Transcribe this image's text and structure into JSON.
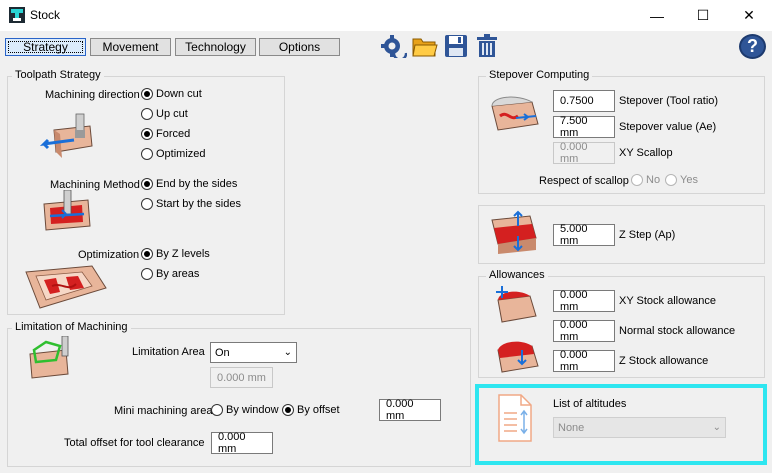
{
  "window": {
    "title": "Stock",
    "minimize_glyph": "—",
    "maximize_glyph": "☐",
    "close_glyph": "✕"
  },
  "tabs": [
    {
      "label": "Strategy",
      "active": true
    },
    {
      "label": "Movement"
    },
    {
      "label": "Technology"
    },
    {
      "label": "Options"
    }
  ],
  "toolbar": {
    "icons": [
      "settings-refresh-icon",
      "open-folder-icon",
      "save-icon",
      "trash-icon",
      "help-icon"
    ],
    "help_glyph": "?"
  },
  "toolpath_strategy": {
    "title": "Toolpath Strategy",
    "machining_direction": {
      "label": "Machining direction",
      "options": [
        "Down cut",
        "Up cut",
        "Forced",
        "Optimized"
      ],
      "selected": [
        "Down cut",
        "Forced"
      ]
    },
    "machining_method": {
      "label": "Machining Method",
      "options": [
        "End by the sides",
        "Start by the sides"
      ],
      "selected": "End by the sides"
    },
    "optimization": {
      "label": "Optimization",
      "options": [
        "By Z levels",
        "By areas"
      ],
      "selected": "By Z levels"
    }
  },
  "limitation": {
    "title": "Limitation of Machining",
    "area_label": "Limitation Area",
    "area_value": "On",
    "area_offset": "0.000 mm",
    "mini_label": "Mini machining area",
    "mini_options": [
      "By window",
      "By offset"
    ],
    "mini_selected": "By offset",
    "mini_value": "0.000 mm",
    "clearance_label": "Total offset for tool clearance",
    "clearance_value": "0.000 mm"
  },
  "stepover": {
    "title": "Stepover Computing",
    "tool_ratio_value": "0.7500",
    "tool_ratio_label": "Stepover (Tool ratio)",
    "ae_value": "7.500 mm",
    "ae_label": "Stepover value (Ae)",
    "scallop_value": "0.000 mm",
    "scallop_label": "XY Scallop",
    "respect_label": "Respect of scallop",
    "respect_options": [
      "No",
      "Yes"
    ]
  },
  "zstep": {
    "value": "5.000 mm",
    "label": "Z Step (Ap)"
  },
  "allowances": {
    "title": "Allowances",
    "xy_value": "0.000 mm",
    "xy_label": "XY Stock allowance",
    "normal_value": "0.000 mm",
    "normal_label": "Normal stock allowance",
    "z_value": "0.000 mm",
    "z_label": "Z  Stock allowance"
  },
  "altitudes": {
    "label": "List of altitudes",
    "value": "None"
  },
  "colors": {
    "highlight": "#2ee6f0",
    "stock": "#e8b59a",
    "accent_red": "#d42020",
    "tab_active_bg": "#dcecfc"
  }
}
